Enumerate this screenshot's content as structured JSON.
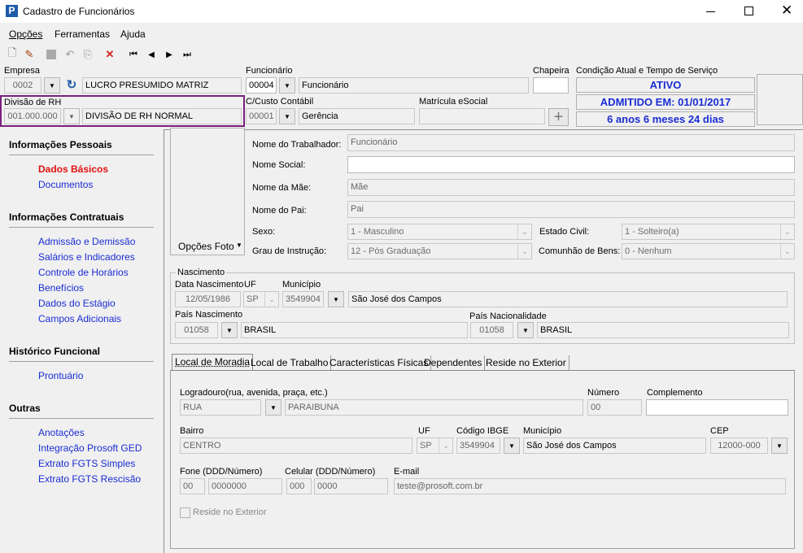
{
  "window": {
    "title": "Cadastro de Funcionários"
  },
  "menu": [
    "Opções",
    "Ferramentas",
    "Ajuda"
  ],
  "header": {
    "empresa_label": "Empresa",
    "empresa_code": "0002",
    "empresa_name": "LUCRO PRESUMIDO MATRIZ",
    "funcionario_label": "Funcionário",
    "funcionario_code": "00004",
    "funcionario_name": "Funcionário",
    "chapeira_label": "Chapeira",
    "chapeira_value": "",
    "condicao_label": "Condição Atual e Tempo de Serviço",
    "status": "ATIVO",
    "admitido": "ADMITIDO EM: 01/01/2017",
    "tempo": "6 anos 6 meses 24 dias",
    "divisao_label": "Divisão de RH",
    "divisao_code": "001.000.000",
    "divisao_name": "DIVISÃO DE RH NORMAL",
    "ccusto_label": "C/Custo Contábil",
    "ccusto_code": "00001",
    "ccusto_name": "Gerência",
    "matricula_label": "Matrícula eSocial",
    "matricula_value": ""
  },
  "nav": {
    "sections": [
      {
        "title": "Informações Pessoais",
        "items": [
          "Dados Básicos",
          "Documentos"
        ]
      },
      {
        "title": "Informações Contratuais",
        "items": [
          "Admissão e Demissão",
          "Salários e Indicadores",
          "Controle de Horários",
          "Benefícios",
          "Dados do Estágio",
          "Campos Adicionais"
        ]
      },
      {
        "title": "Histórico Funcional",
        "items": [
          "Prontuário"
        ]
      },
      {
        "title": "Outras",
        "items": [
          "Anotações",
          "Integração Prosoft GED",
          "Extrato FGTS Simples",
          "Extrato FGTS Rescisão"
        ]
      }
    ]
  },
  "dados": {
    "foto_button": "Opções Foto",
    "nome_label": "Nome do Trabalhador:",
    "nome_value": "Funcionário",
    "social_label": "Nome Social:",
    "social_value": "",
    "mae_label": "Nome da Mãe:",
    "mae_value": "Mãe",
    "pai_label": "Nome do Pai:",
    "pai_value": "Pai",
    "sexo_label": "Sexo:",
    "sexo_value": "1 - Masculino",
    "civil_label": "Estado Civil:",
    "civil_value": "1 - Solteiro(a)",
    "grau_label": "Grau de Instrução:",
    "grau_value": "12 - Pós Graduação",
    "comunhao_label": "Comunhão de Bens:",
    "comunhao_value": "0 - Nenhum"
  },
  "nascimento": {
    "group": "Nascimento",
    "data_label": "Data Nascimento",
    "data_value": "12/05/1986",
    "uf_label": "UF",
    "uf_value": "SP",
    "mun_label": "Município",
    "mun_code": "3549904",
    "mun_name": "São José dos Campos",
    "pais_label": "País Nascimento",
    "pais_code": "01058",
    "pais_name": "BRASIL",
    "nac_label": "País Nacionalidade",
    "nac_code": "01058",
    "nac_name": "BRASIL"
  },
  "tabs": [
    "Local de Moradia",
    "Local de Trabalho",
    "Características Físicas",
    "Dependentes",
    "Reside no Exterior"
  ],
  "endereco": {
    "logradouro_label": "Logradouro(rua, avenida, praça, etc.)",
    "tipo_value": "RUA",
    "logradouro_value": "PARAIBUNA",
    "numero_label": "Número",
    "numero_value": "00",
    "complemento_label": "Complemento",
    "complemento_value": "",
    "bairro_label": "Bairro",
    "bairro_value": "CENTRO",
    "uf_label": "UF",
    "uf_value": "SP",
    "ibge_label": "Código IBGE",
    "ibge_value": "3549904",
    "mun_label": "Município",
    "mun_value": "São José dos Campos",
    "cep_label": "CEP",
    "cep_value": "12000-000",
    "fone_label": "Fone (DDD/Número)",
    "fone_ddd": "00",
    "fone_num": "0000000",
    "cel_label": "Celular (DDD/Número)",
    "cel_ddd": "000",
    "cel_num": "0000",
    "email_label": "E-mail",
    "email_value": "teste@prosoft.com.br",
    "reside_label": "Reside no Exterior"
  }
}
